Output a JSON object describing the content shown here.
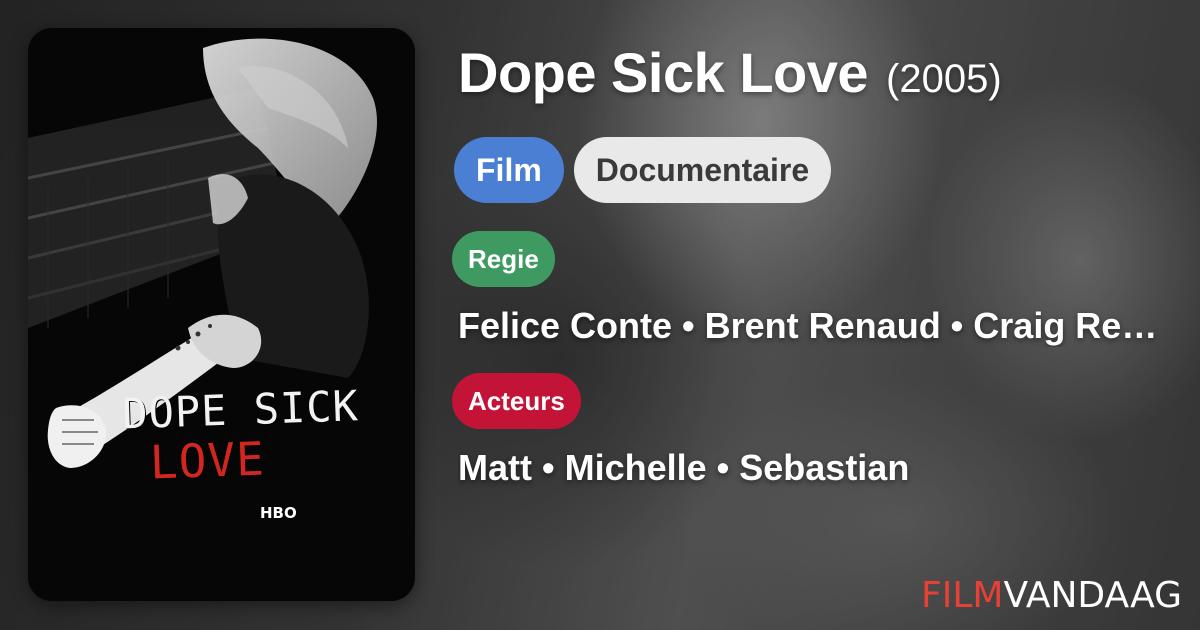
{
  "movie": {
    "title": "Dope Sick Love",
    "year": "(2005)"
  },
  "chips": {
    "type": "Film",
    "genre": "Documentaire"
  },
  "sections": {
    "directors_label": "Regie",
    "directors": "Felice Conte • Brent Renaud • Craig Renaud",
    "cast_label": "Acteurs",
    "cast": "Matt • Michelle • Sebastian"
  },
  "poster": {
    "title_line1": "DOPE SICK",
    "title_line2": "LOVE",
    "logo": "HBO"
  },
  "brand": {
    "part1": "FILM",
    "part2": "VANDAAG"
  },
  "colors": {
    "film_chip": "#4a7fd3",
    "genre_chip": "#e9e9e9",
    "regie_badge": "#3f9a62",
    "acteurs_badge": "#c31438",
    "brand_red": "#e84034"
  }
}
